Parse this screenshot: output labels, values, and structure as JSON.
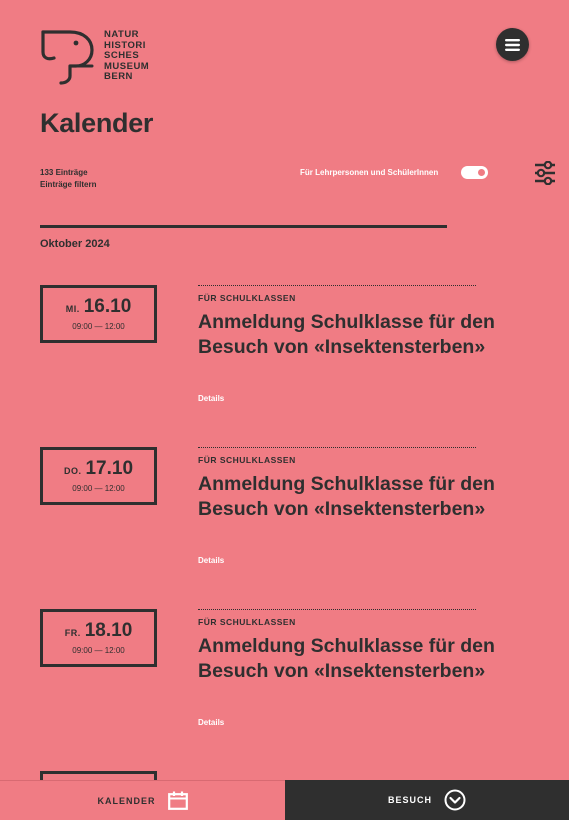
{
  "brand": {
    "lines": [
      "NATUR",
      "HISTORI",
      "SCHES",
      "MUSEUM",
      "BERN"
    ]
  },
  "page_title": "Kalender",
  "entries_count": "133 Einträge",
  "filter_link": "Einträge filtern",
  "teacher_toggle": {
    "label": "Für Lehrpersonen und SchülerInnen",
    "enabled": true
  },
  "month": "Oktober 2024",
  "events": [
    {
      "weekday": "MI.",
      "date": "16.10",
      "time": "09:00 — 12:00",
      "category": "FÜR SCHULKLASSEN",
      "title": "Anmeldung Schulklasse für den Besuch von «Insektensterben»",
      "details": "Details"
    },
    {
      "weekday": "DO.",
      "date": "17.10",
      "time": "09:00 — 12:00",
      "category": "FÜR SCHULKLASSEN",
      "title": "Anmeldung Schulklasse für den Besuch von «Insektensterben»",
      "details": "Details"
    },
    {
      "weekday": "FR.",
      "date": "18.10",
      "time": "09:00 — 12:00",
      "category": "FÜR SCHULKLASSEN",
      "title": "Anmeldung Schulklasse für den Besuch von «Insektensterben»",
      "details": "Details"
    }
  ],
  "bottom_nav": {
    "left_label": "KALENDER",
    "left_icon": "calendar-icon",
    "right_label": "BESUCH",
    "right_icon": "chevron-down-circle-icon"
  },
  "colors": {
    "background": "#f07c84",
    "dark": "#2f2f2f",
    "white": "#ffffff"
  }
}
